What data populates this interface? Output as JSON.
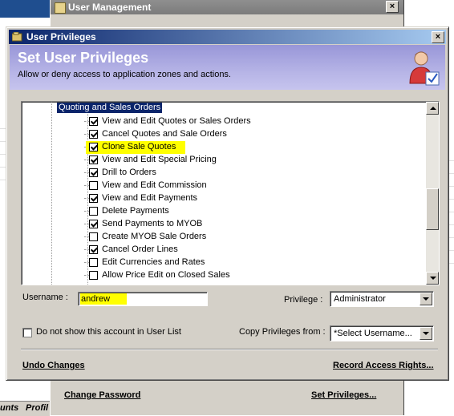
{
  "background_window": {
    "title": "User Management",
    "links": {
      "change_password": "Change Password",
      "set_privileges": "Set Privileges..."
    }
  },
  "left_tabs": [
    "unts",
    "Profil"
  ],
  "dialog": {
    "title": "User Privileges",
    "banner": {
      "title": "Set User Privileges",
      "subtitle": "Allow or deny access to application zones and actions."
    },
    "tree": {
      "parent": "Quoting and Sales Orders",
      "items": [
        {
          "label": "View and Edit Quotes or Sales Orders",
          "checked": true
        },
        {
          "label": "Cancel Quotes and Sale Orders",
          "checked": true
        },
        {
          "label": "Clone Sale Quotes",
          "checked": true,
          "highlighted": true
        },
        {
          "label": "View and Edit Special Pricing",
          "checked": true
        },
        {
          "label": "Drill to Orders",
          "checked": true
        },
        {
          "label": "View and Edit Commission",
          "checked": false
        },
        {
          "label": "View and Edit Payments",
          "checked": true
        },
        {
          "label": "Delete Payments",
          "checked": false
        },
        {
          "label": "Send Payments to MYOB",
          "checked": true
        },
        {
          "label": "Create MYOB Sale Orders",
          "checked": false
        },
        {
          "label": "Cancel Order Lines",
          "checked": true
        },
        {
          "label": "Edit Currencies and Rates",
          "checked": false
        },
        {
          "label": "Allow Price Edit on Closed Sales",
          "checked": false
        }
      ]
    },
    "form": {
      "username_label": "Username :",
      "username_value": "andrew",
      "privilege_label": "Privilege :",
      "privilege_value": "Administrator",
      "hide_account_label": "Do not show this account in User List",
      "copy_privileges_label": "Copy Privileges from :",
      "copy_privileges_value": "*Select Username..."
    },
    "footer": {
      "undo": "Undo Changes",
      "record": "Record Access Rights..."
    }
  },
  "colors": {
    "title_bar": "#0a246a",
    "banner": "#9896d8",
    "highlight": "#ffff00",
    "face": "#d4d0c8"
  }
}
